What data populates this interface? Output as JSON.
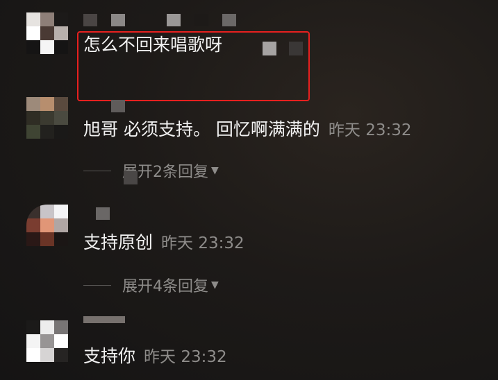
{
  "comments": [
    {
      "text": "怎么不回来唱歌呀",
      "time": "",
      "replies": ""
    },
    {
      "text": "旭哥 必须支持。 回忆啊满满的",
      "time": "昨天 23:32",
      "replies": "展开2条回复"
    },
    {
      "text": "支持原创",
      "time": "昨天 23:32",
      "replies": "展开4条回复"
    },
    {
      "text": "支持你",
      "time": "昨天 23:32",
      "replies": ""
    }
  ],
  "icons": {
    "expand": "triangle-down-icon"
  },
  "colors": {
    "background": "#1d1a18",
    "text": "#f2f2f2",
    "secondary": "#8e8c8a",
    "highlight": "#e8201f"
  }
}
